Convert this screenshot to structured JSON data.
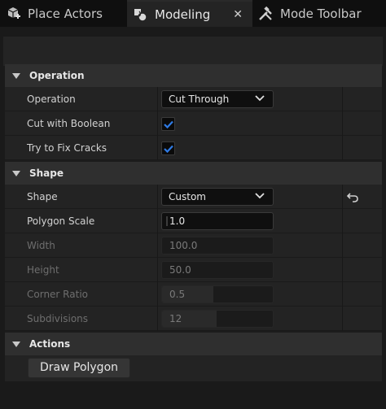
{
  "tabs": [
    {
      "label": "Place Actors",
      "icon": "place-actors-icon"
    },
    {
      "label": "Modeling",
      "icon": "modeling-icon",
      "active": true
    },
    {
      "label": "Mode Toolbar",
      "icon": "tools-icon"
    }
  ],
  "tab_close_glyph": "✕",
  "details": {
    "operation_category": "Operation",
    "operation_label": "Operation",
    "operation_value": "Cut Through",
    "cut_with_boolean_label": "Cut with Boolean",
    "cut_with_boolean_checked": true,
    "fix_cracks_label": "Try to Fix Cracks",
    "fix_cracks_checked": true,
    "shape_category": "Shape",
    "shape_label": "Shape",
    "shape_value": "Custom",
    "polygon_scale_label": "Polygon Scale",
    "polygon_scale_value": "1.0",
    "width_label": "Width",
    "width_value": "100.0",
    "height_label": "Height",
    "height_value": "50.0",
    "corner_ratio_label": "Corner Ratio",
    "corner_ratio_value": "0.5",
    "subdivisions_label": "Subdivisions",
    "subdivisions_value": "12",
    "actions_category": "Actions",
    "draw_polygon_label": "Draw Polygon"
  },
  "colors": {
    "accent_check": "#1f6fd6",
    "category_bg": "#2f2f2f",
    "row_bg": "#232323"
  }
}
